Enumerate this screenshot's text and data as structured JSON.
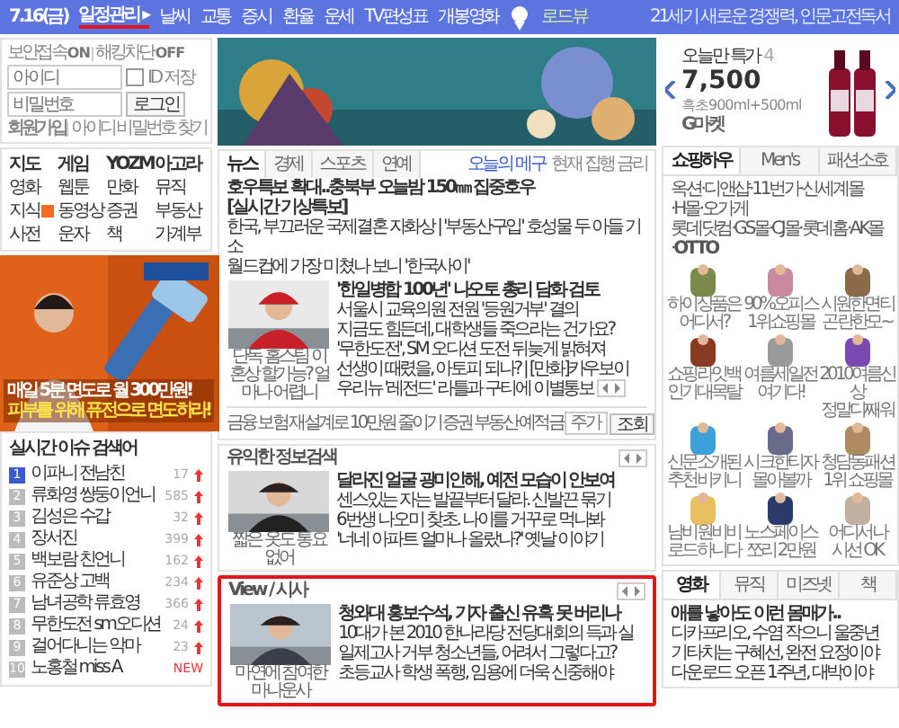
{
  "top_bar": {
    "date": "7.16(금)",
    "schedule": "일정관리 ▸",
    "schedule_marked": true,
    "links": [
      "날씨",
      "교통",
      "증시",
      "환율",
      "운세",
      "TV편성표",
      "개봉영화"
    ],
    "roadview": "로드뷰",
    "promo": "21세기 새로운 경쟁력, 인문고전독서"
  },
  "login": {
    "secure": "보안접속",
    "secure_state": "ON",
    "hack": "해킹차단",
    "hack_state": "OFF",
    "id_placeholder": "아이디",
    "pw_placeholder": "비밀번호",
    "save_id": {
      "label": "ID 저장",
      "checked": false
    },
    "button": "로그인",
    "join": "회원가입",
    "find_id": "아이디",
    "find_pw": "비밀번호 찾기"
  },
  "services": {
    "headers": [
      "지도",
      "게임",
      "YOZM",
      "아고라"
    ],
    "items": [
      {
        "label": "영화",
        "new": false
      },
      {
        "label": "웹툰",
        "new": false
      },
      {
        "label": "만화",
        "new": false
      },
      {
        "label": "뮤직",
        "new": false
      },
      {
        "label": "지식",
        "new": true
      },
      {
        "label": "동영상",
        "new": false
      },
      {
        "label": "증권",
        "new": false
      },
      {
        "label": "부동산",
        "new": false
      },
      {
        "label": "사전",
        "new": false
      },
      {
        "label": "운자",
        "new": false
      },
      {
        "label": "책",
        "new": false
      },
      {
        "label": "가계부",
        "new": false
      }
    ]
  },
  "ad": {
    "line_1": "매일 5분 면도로 월 300만원!",
    "line_2": "피부를 위해 퓨전으로 면도하라!"
  },
  "realtime": {
    "title": "실시간 이슈 검색어",
    "items": [
      {
        "rank": "1",
        "term": "이파니 전남친",
        "change": "17",
        "rising": true,
        "top": true
      },
      {
        "rank": "2",
        "term": "류화영 쌍둥이언니",
        "change": "585",
        "rising": true,
        "top": false
      },
      {
        "rank": "3",
        "term": "김성은 수갑",
        "change": "32",
        "rising": true,
        "top": false
      },
      {
        "rank": "4",
        "term": "장서진",
        "change": "399",
        "rising": true,
        "top": false
      },
      {
        "rank": "5",
        "term": "백보람 친언니",
        "change": "162",
        "rising": true,
        "top": false
      },
      {
        "rank": "6",
        "term": "유준상 고백",
        "change": "234",
        "rising": true,
        "top": false
      },
      {
        "rank": "7",
        "term": "남녀공학 류효영",
        "change": "366",
        "rising": true,
        "top": false
      },
      {
        "rank": "8",
        "term": "무한도전 sm오디션",
        "change": "24",
        "rising": true,
        "top": false
      },
      {
        "rank": "9",
        "term": "걸어다니는 악마",
        "change": "23",
        "rising": true,
        "top": false
      },
      {
        "rank": "10",
        "term": "노홍철 miss A",
        "change": "NEW",
        "rising": false,
        "top": false
      }
    ]
  },
  "news": {
    "tabs": [
      {
        "label": "뉴스",
        "selected": true
      },
      {
        "label": "경제",
        "selected": false
      },
      {
        "label": "스포츠",
        "selected": false
      },
      {
        "label": "연예",
        "selected": false
      }
    ],
    "today": "오늘의 메구",
    "today_sub": "현재 집행 금리",
    "headline": "호우특보 확대..충북부 오늘밤 150㎜ 집중호우",
    "headline_tag": "[실시간 기상특보]",
    "lines": [
      "한국, 부끄러운 국제결혼 자화상 | '부동산구입' 호성물 두 아들 기소",
      "월드컵에 가장 미쳤나 보니 '한국사이'"
    ],
    "photo_caption": "단독 홈스팀 이혼상 할가능? 얼마나 어렵니",
    "photo_headline": "'한일병합 100년' 나오토 총리 담화 검토",
    "photo_lines": [
      "서울시 교육의원 전원 '등원거부' 결의",
      "지금도 힘든데, 대학생들 죽으라는 건가요?",
      "'무한도전', SM 오디션 도전 뒤늦게 밝혀져",
      "선생이 때렸을, 아토피 되나? | [만화]카우보이",
      "우리뉴 '레전드' 라틀과 구티에 이별통보"
    ],
    "finance_label": "금융",
    "finance_text": "보험 재설계로 10만원 줄이기",
    "finance_links": [
      "증권",
      "부동산",
      "예적금"
    ],
    "stock_placeholder": "주가",
    "stock_button": "조회"
  },
  "info": {
    "title": "유익한 정보검색",
    "photo_caption": "짧은 옷도 통요없어",
    "headline": "달라진 얼굴 광미인해, 예전 모습이 안보여",
    "lines": [
      "센스있는 자는 발끝부터 달라. 신발끈 묶기",
      "6번생 나오미 찾초. 나이를 거꾸로 먹나봐",
      "'너네 아파트 얼마나 올랐나?' 옛날 이야기"
    ]
  },
  "view": {
    "title": "View / 시사",
    "marked": true,
    "photo_caption": "마연에 참여한 마나운사",
    "headline": "청와대 홍보수석, 기자 출신 유혹 못 버리나",
    "lines": [
      "10대가 본 2010 한나라당 전당대회의 득과 실",
      "일제고사 거부 청소년들, 어려서 그렇다고?",
      "초등교사 학생 폭행, 임용에 더욱 신중해야"
    ]
  },
  "deal": {
    "title": "오늘만 특가",
    "count": "4",
    "price": "7,500",
    "desc": "흑초900ml+500ml",
    "seller": "G마켓"
  },
  "shopping": {
    "tabs": [
      {
        "label": "쇼핑하우",
        "selected": true
      },
      {
        "label": "Men's",
        "selected": false
      },
      {
        "label": "패션소호",
        "selected": false
      }
    ],
    "malls": [
      "옥션·디앤샵·11번가·신세계몰·H몰·오가게",
      "롯데닷컴·GS몰·CJ몰·롯데홈·AK몰·**OTTO**"
    ],
    "products": [
      "하이상품은 어디서?",
      "90%오피스 1위쇼핑몰",
      "시원한면티 곤란한모~",
      "쇼핑라잇백 인기대목탈",
      "여름세일전 여기다!",
      "2010여름신상 정말디째워",
      "신문소개된 추천비키니",
      "시크한티자 몰아볼까",
      "청담동패션 1위 쇼핑몰",
      "남비원비비 로드하니다",
      "노스페이스 쪼리 2만원",
      "어디서나 시선 OK"
    ]
  },
  "movie": {
    "tabs": [
      {
        "label": "영화",
        "selected": true
      },
      {
        "label": "뮤직",
        "selected": false
      },
      {
        "label": "미즈넷",
        "selected": false
      },
      {
        "label": "책",
        "selected": false
      }
    ],
    "headline": "애를 낳아도 이런 몸매가..",
    "lines": [
      "디카프리오, 수염 작으니 울중년",
      "기타치는 구혜선, 완전 요정이야",
      "다운로드 오픈 1주년, 대박이야"
    ]
  }
}
